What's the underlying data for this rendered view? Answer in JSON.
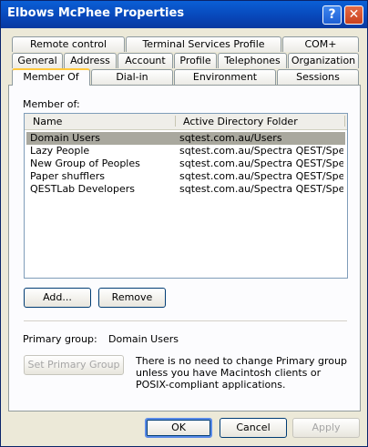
{
  "window": {
    "title": "Elbows McPhee Properties"
  },
  "titlebar": {
    "help_glyph": "?",
    "close_glyph": "✕"
  },
  "tabs": {
    "row1": [
      "Remote control",
      "Terminal Services Profile",
      "COM+"
    ],
    "row2": [
      "General",
      "Address",
      "Account",
      "Profile",
      "Telephones",
      "Organization"
    ],
    "row3": [
      "Member Of",
      "Dial-in",
      "Environment",
      "Sessions"
    ],
    "active": "Member Of"
  },
  "member_of": {
    "label": "Member of:",
    "columns": [
      "Name",
      "Active Directory Folder"
    ],
    "rows": [
      {
        "name": "Domain Users",
        "folder": "sqtest.com.au/Users",
        "selected": true
      },
      {
        "name": "Lazy People",
        "folder": "sqtest.com.au/Spectra QEST/Spe...",
        "selected": false
      },
      {
        "name": "New Group of Peoples",
        "folder": "sqtest.com.au/Spectra QEST/Spe...",
        "selected": false
      },
      {
        "name": "Paper shufflers",
        "folder": "sqtest.com.au/Spectra QEST/Spe...",
        "selected": false
      },
      {
        "name": "QESTLab Developers",
        "folder": "sqtest.com.au/Spectra QEST/Spe...",
        "selected": false
      }
    ]
  },
  "buttons": {
    "add": "Add...",
    "remove": "Remove",
    "set_primary": "Set Primary Group",
    "ok": "OK",
    "cancel": "Cancel",
    "apply": "Apply"
  },
  "primary_group": {
    "label": "Primary group:",
    "value": "Domain Users",
    "note": "There is no need to change Primary group unless you have Macintosh clients or POSIX-compliant applications."
  },
  "colors": {
    "selection": "#a9a89e",
    "active_tab_accent": "#ffc83c",
    "titlebar": "#0846b8"
  }
}
